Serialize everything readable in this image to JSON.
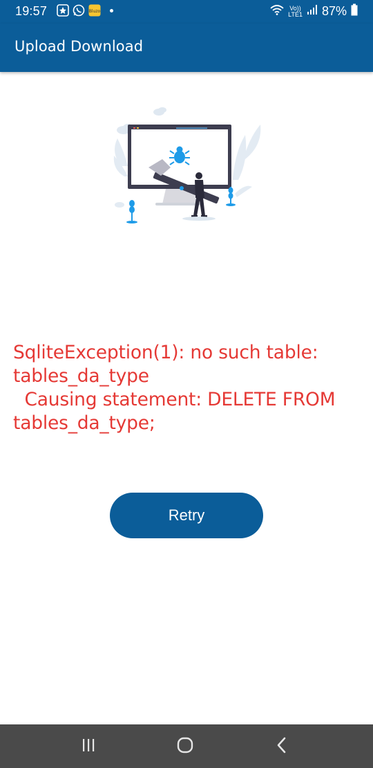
{
  "status_bar": {
    "time": "19:57",
    "battery": "87%",
    "network": "LTE1",
    "volte": "Vo))",
    "icons_left": [
      "app-notification-icon",
      "whatsapp-icon",
      "bluzo-icon",
      "notification-dot"
    ],
    "icons_right": [
      "wifi-icon",
      "volte-lte-icon",
      "signal-icon",
      "battery-icon"
    ]
  },
  "app_bar": {
    "title": "Upload Download"
  },
  "error": {
    "message": "SqliteException(1): no such table: tables_da_type\n  Causing statement: DELETE FROM tables_da_type;"
  },
  "actions": {
    "retry_label": "Retry"
  },
  "nav_bar": {
    "items": [
      "recent-apps-icon",
      "home-icon",
      "back-icon"
    ]
  },
  "colors": {
    "primary": "#0b5d99",
    "error": "#e53935",
    "nav_background": "#4a4a4a"
  }
}
